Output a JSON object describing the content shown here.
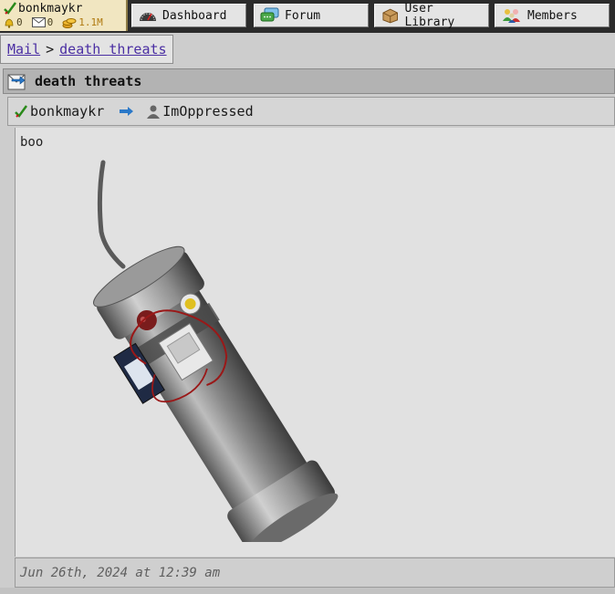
{
  "user": {
    "name": "bonkmaykr",
    "alerts": "0",
    "mail": "0",
    "coins": "1.1M"
  },
  "nav": {
    "dashboard": "Dashboard",
    "forum": "Forum",
    "library": "User Library",
    "members": "Members"
  },
  "breadcrumb": {
    "root": "Mail",
    "separator": ">",
    "current": "death threats"
  },
  "thread": {
    "title": "death threats",
    "sender": "bonkmaykr",
    "recipient": "ImOppressed"
  },
  "message": {
    "body": "boo",
    "timestamp": "Jun 26th, 2024 at 12:39 am"
  },
  "icons": {
    "user": "checkmark-quill-icon",
    "alerts": "bell-icon",
    "mail": "envelope-icon",
    "coins": "coin-stack-icon",
    "dashboard": "speedometer-icon",
    "forum": "chat-bubbles-icon",
    "library": "box-icon",
    "members": "people-icon",
    "thread": "mail-reply-icon",
    "arrow": "right-arrow-icon",
    "recipient": "person-icon"
  }
}
